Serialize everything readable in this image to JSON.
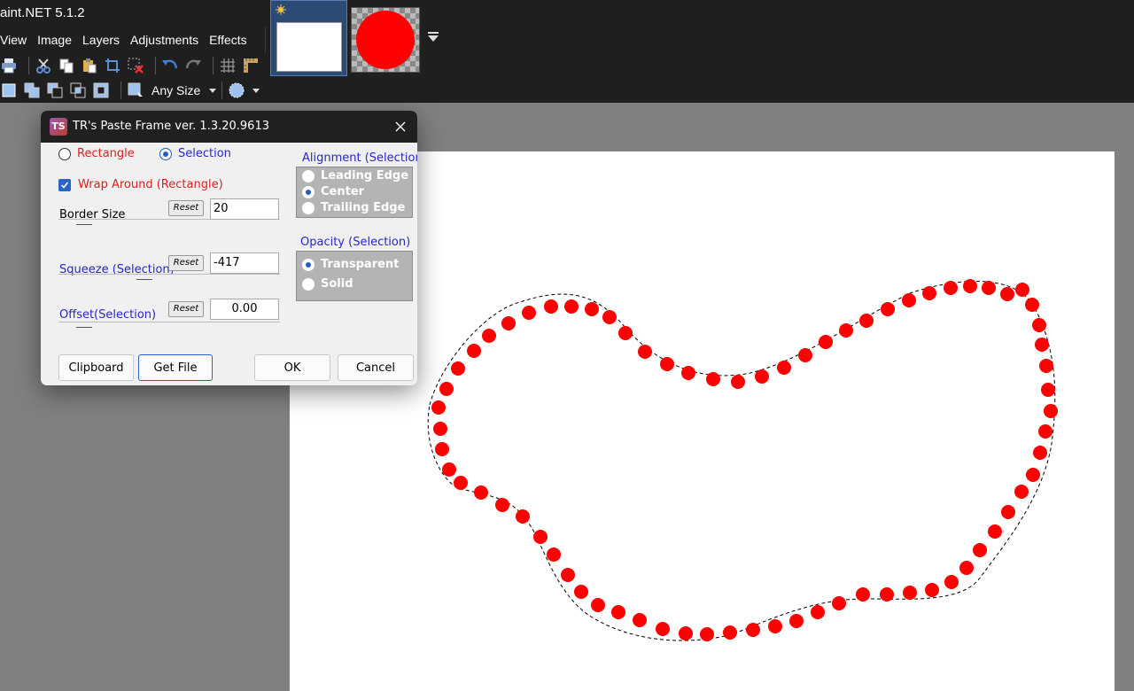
{
  "app": {
    "title": "aint.NET 5.1.2"
  },
  "menu": {
    "items": [
      "View",
      "Image",
      "Layers",
      "Adjustments",
      "Effects"
    ]
  },
  "toolbar": {
    "selection_size": "Any Size"
  },
  "colors": {
    "accent": "#2a64c8",
    "brand_red": "#ff0000",
    "label_blue": "#2a26c9",
    "label_red": "#e0201c",
    "chrome_dark": "#1f1f1f"
  },
  "icons": [
    "print-icon",
    "cut-icon",
    "copy-icon",
    "paste-icon",
    "crop-icon",
    "deselect-icon",
    "undo-icon",
    "redo-icon",
    "grid-icon",
    "ruler-icon",
    "selection-mode-icon",
    "antialias-icon"
  ],
  "dialog": {
    "title": "TR's Paste Frame ver. 1.3.20.9613",
    "logo": "TS",
    "mode": {
      "rectangle": "Rectangle",
      "selection": "Selection",
      "selected": "Selection"
    },
    "wrap_around": {
      "label": "Wrap Around  (Rectangle)",
      "checked": true
    },
    "border_size": {
      "label": "Border Size",
      "reset": "Reset",
      "value": "20"
    },
    "squeeze": {
      "label": "Squeeze (Selection)",
      "reset": "Reset",
      "value": "-417"
    },
    "offset": {
      "label": "Offset(Selection)",
      "reset": "Reset",
      "value": "0.00"
    },
    "alignment": {
      "label": "Alignment (Selection",
      "options": [
        "Leading Edge",
        "Center",
        "Trailing Edge"
      ],
      "selected": "Center"
    },
    "opacity": {
      "label": "Opacity (Selection)",
      "options": [
        "Transparent",
        "Solid"
      ],
      "selected": "Transparent"
    },
    "buttons": {
      "clipboard": "Clipboard",
      "get_file": "Get File",
      "ok": "OK",
      "cancel": "Cancel"
    }
  }
}
